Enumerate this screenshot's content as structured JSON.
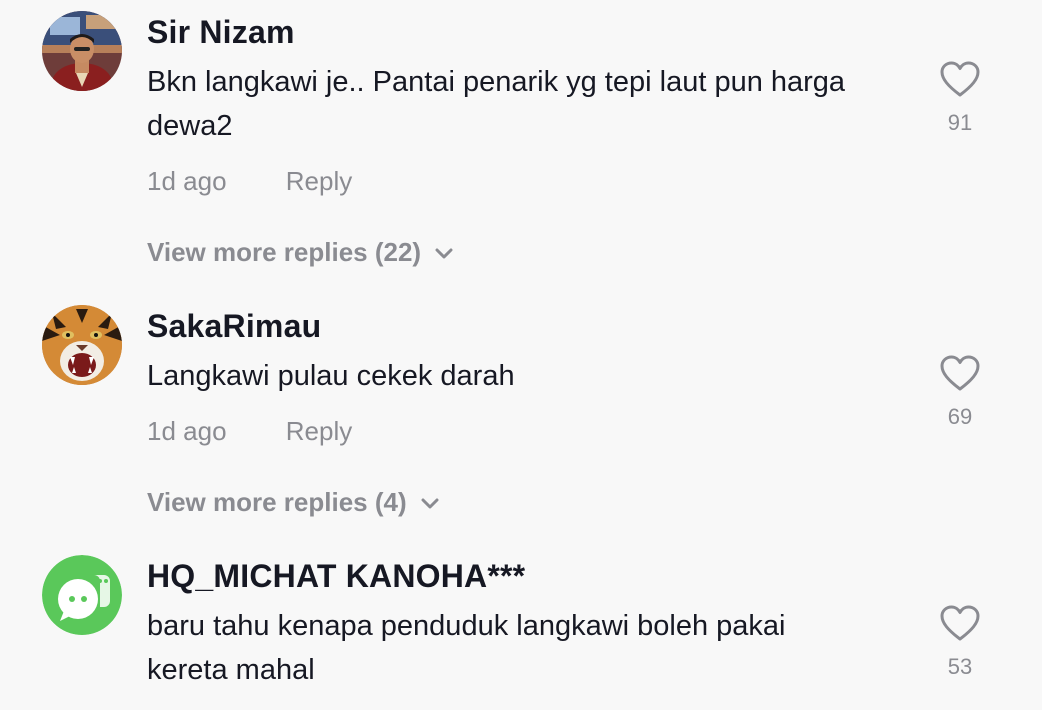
{
  "comments": [
    {
      "username": "Sir Nizam",
      "text": "Bkn langkawi je.. Pantai penarik yg tepi laut pun harga dewa2",
      "time": "1d ago",
      "reply_label": "Reply",
      "likes": "91",
      "view_more": "View more replies (22)",
      "avatar_icon": "person-photo-avatar"
    },
    {
      "username": "SakaRimau",
      "text": "Langkawi pulau cekek darah",
      "time": "1d ago",
      "reply_label": "Reply",
      "likes": "69",
      "view_more": "View more replies (4)",
      "avatar_icon": "tiger-photo-avatar"
    },
    {
      "username": "HQ_MICHAT KANOHA***",
      "text": "baru tahu kenapa penduduk langkawi boleh pakai kereta mahal",
      "likes": "53",
      "avatar_icon": "michat-logo-avatar"
    }
  ],
  "colors": {
    "background": "#f8f8f8",
    "text_primary": "#161823",
    "text_secondary": "#8a8b91",
    "michat_green": "#5ac85a"
  }
}
